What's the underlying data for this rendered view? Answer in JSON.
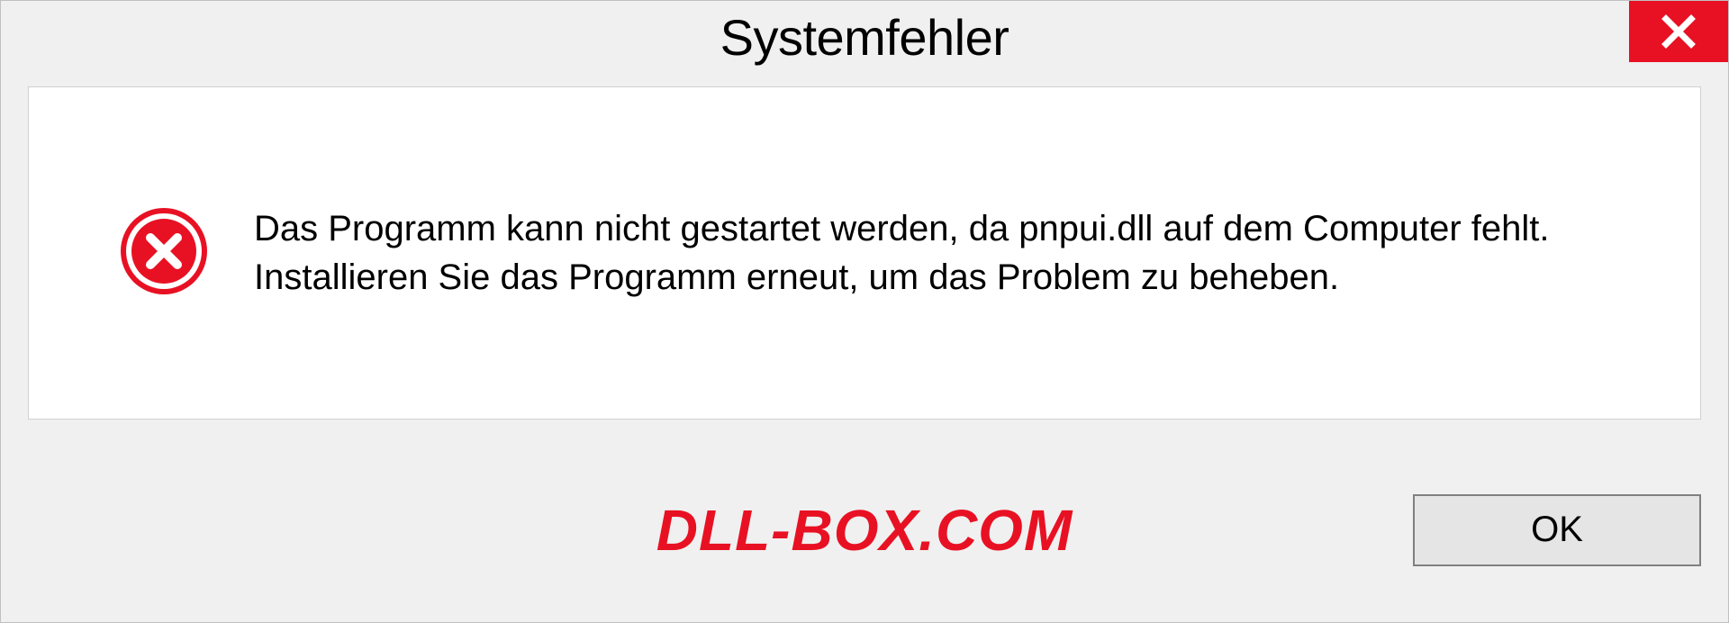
{
  "dialog": {
    "title": "Systemfehler",
    "message": "Das Programm kann nicht gestartet werden, da pnpui.dll auf dem Computer fehlt. Installieren Sie das Programm erneut, um das Problem zu beheben.",
    "ok_label": "OK"
  },
  "watermark": "DLL-BOX.COM"
}
